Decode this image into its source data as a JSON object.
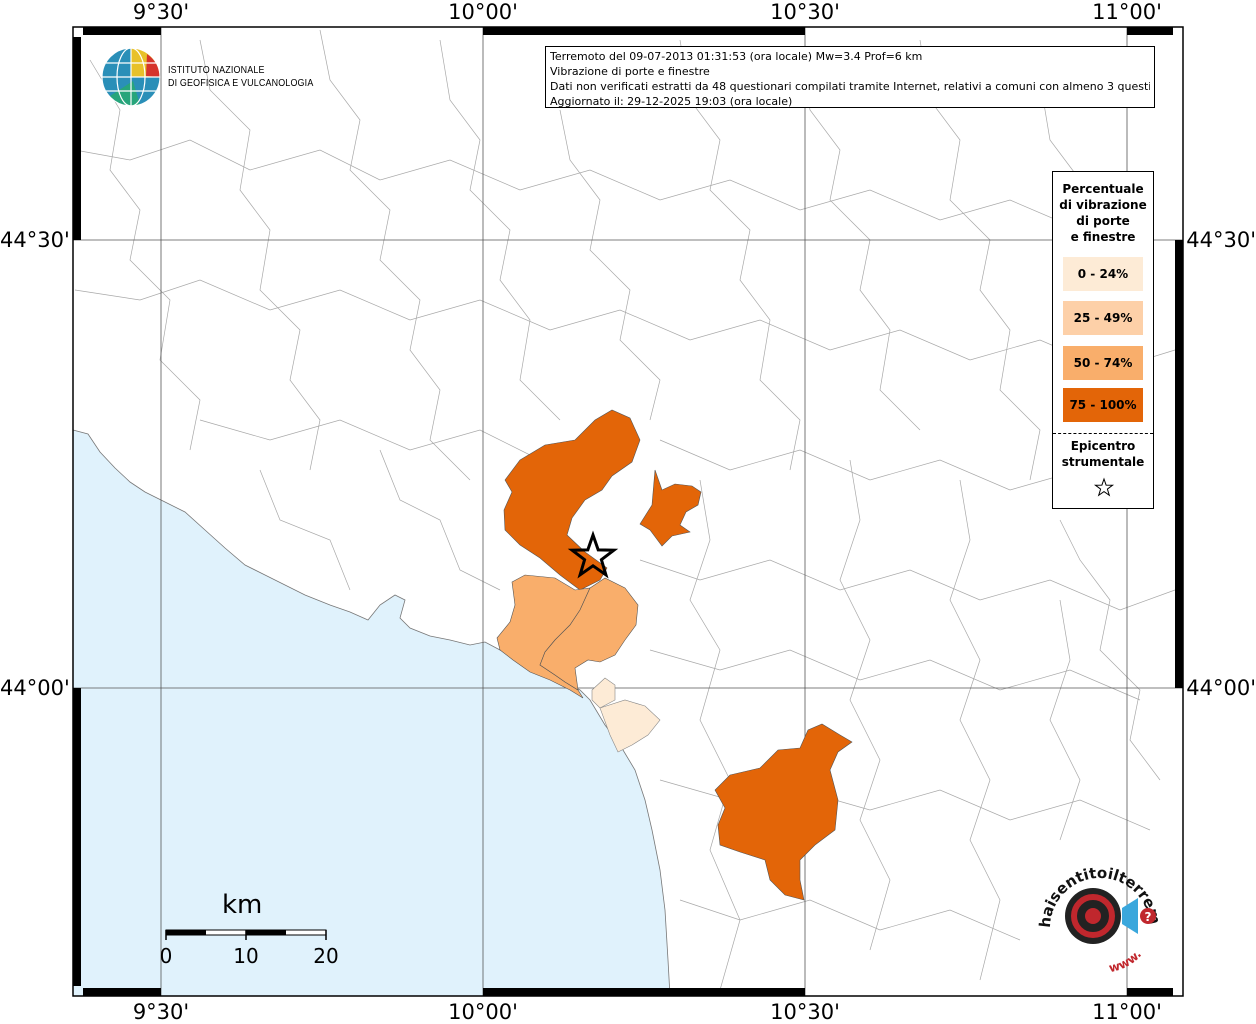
{
  "axes": {
    "longitude_labels": [
      "9°30'",
      "10°00'",
      "10°30'",
      "11°00'"
    ],
    "latitude_labels": [
      "44°30'",
      "44°00'"
    ]
  },
  "info": {
    "line1": "Terremoto del 09-07-2013 01:31:53 (ora locale) Mw=3.4 Prof=6 km",
    "line2": "Vibrazione di porte e finestre",
    "line3": "Dati non verificati estratti da 48 questionari compilati tramite Internet, relativi a comuni con almeno 3 questionari.",
    "line4": "Aggiornato il: 29-12-2025 19:03 (ora locale)"
  },
  "logo": {
    "line1": "ISTITUTO NAZIONALE",
    "line2": "DI GEOFISICA E VULCANOLOGIA"
  },
  "legend": {
    "title_lines": [
      "Percentuale",
      "di vibrazione",
      "di porte",
      "e finestre"
    ],
    "classes": [
      {
        "label": "0 - 24%",
        "color": "#fdebd6"
      },
      {
        "label": "25 - 49%",
        "color": "#fdd0a8"
      },
      {
        "label": "50 - 74%",
        "color": "#f9ae6b"
      },
      {
        "label": "75 - 100%",
        "color": "#e36508"
      }
    ],
    "epicenter_lines": [
      "Epicentro",
      "strumentale"
    ]
  },
  "scale_bar": {
    "title": "km",
    "ticks": [
      "0",
      "10",
      "20"
    ]
  },
  "watermark": {
    "text": "haisentitoilterremoto.it",
    "url_text": "www.",
    "mark": "?"
  },
  "colors": {
    "sea": "#e0f2fc",
    "class_0_24": "#fdebd6",
    "class_25_49": "#fdd0a8",
    "class_50_74": "#f9ae6b",
    "class_75_100": "#e36508"
  }
}
